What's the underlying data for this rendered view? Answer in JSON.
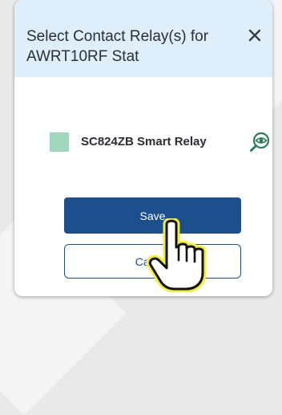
{
  "dialog": {
    "title": "Select Contact Relay(s) for AWRT10RF Stat",
    "close_icon": "close-icon"
  },
  "relays": [
    {
      "name": "SC824ZB Smart Relay",
      "swatch_color": "#9fd6bd",
      "locate_icon": "locate-eye-icon"
    }
  ],
  "actions": {
    "save_label": "Save",
    "cancel_label": "Cancel"
  },
  "colors": {
    "header_bg": "#deeefa",
    "primary": "#1c4f8c",
    "cursor_highlight": "#f2ee3a"
  }
}
